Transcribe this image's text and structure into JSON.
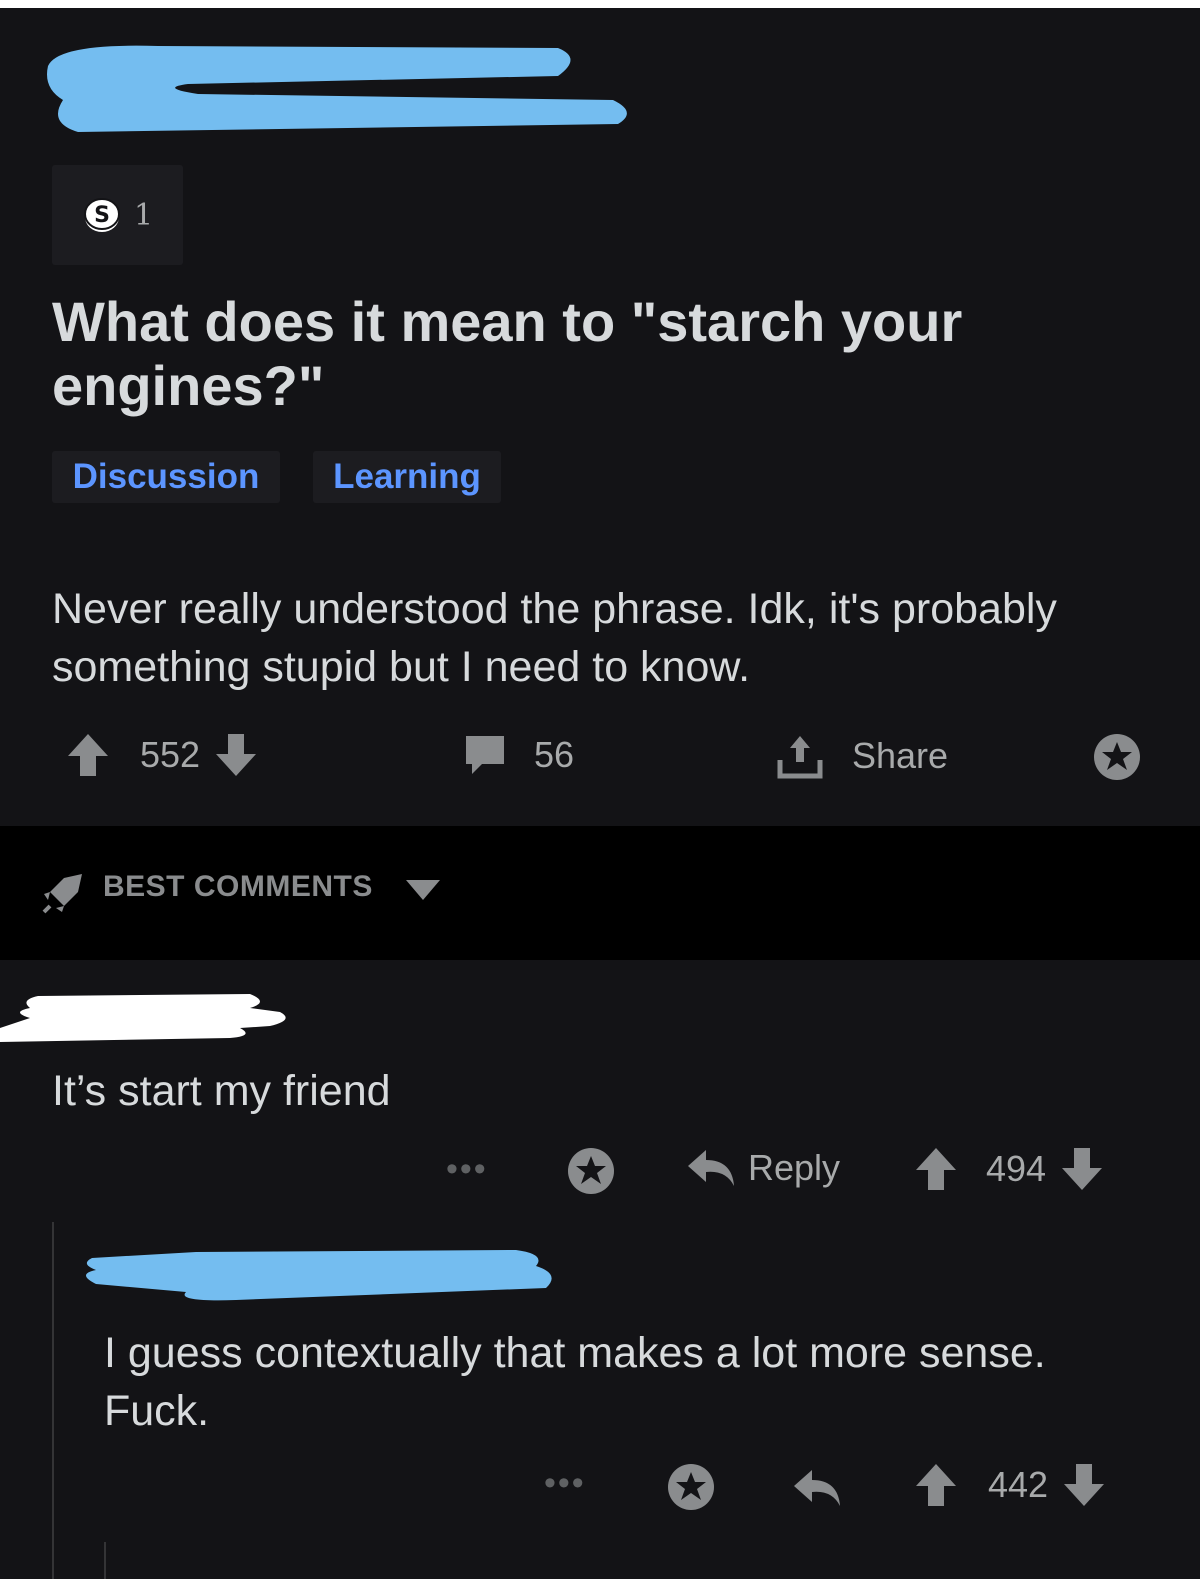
{
  "post": {
    "award_count": "1",
    "title": "What does it mean to \"starch your engines?\"",
    "flairs": [
      "Discussion",
      "Learning"
    ],
    "body": "Never really understood the phrase. Idk, it's probably something stupid but I need to know.",
    "upvotes": "552",
    "comments": "56",
    "share_label": "Share"
  },
  "sort": {
    "label": "BEST COMMENTS"
  },
  "comments": [
    {
      "text": "It’s start my friend",
      "reply_label": "Reply",
      "score": "494"
    },
    {
      "text": "I guess contextually that makes a lot more sense. Fuck.",
      "score": "442"
    }
  ],
  "colors": {
    "background": "#131316",
    "flair_text": "#5c95ff",
    "redaction_blue": "#74bdf0",
    "redaction_white": "#ffffff",
    "icon_gray": "#8a8c8e"
  },
  "icons": [
    "award-icon",
    "upvote-icon",
    "downvote-icon",
    "comment-icon",
    "share-icon",
    "award-star-icon",
    "rocket-icon",
    "chevron-down-icon",
    "reply-icon",
    "more-icon"
  ]
}
